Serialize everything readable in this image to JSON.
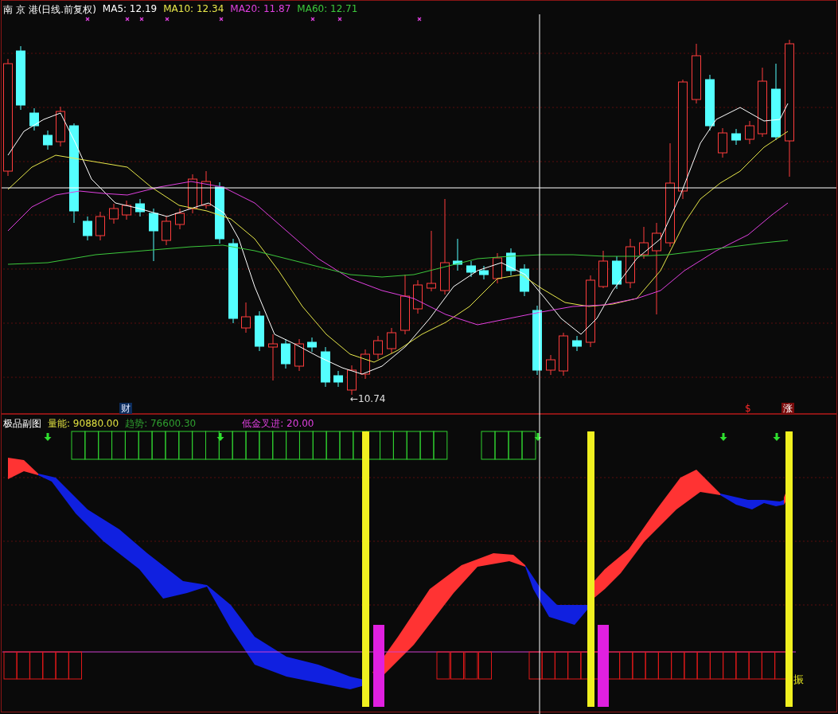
{
  "main_chart": {
    "title": "南 京 港(日线.前复权)",
    "indicators": [
      {
        "label": "MA5: 12.19",
        "color": "#ffffff"
      },
      {
        "label": "MA10: 12.34",
        "color": "#e8e84a"
      },
      {
        "label": "MA20: 11.87",
        "color": "#e040e0"
      },
      {
        "label": "MA60: 12.71",
        "color": "#3cc83c"
      }
    ],
    "low_label": "←10.74",
    "markers": [
      {
        "text": "财",
        "kind": "news"
      },
      {
        "text": "$",
        "kind": "dividend"
      },
      {
        "text": "涨",
        "kind": "limit"
      }
    ]
  },
  "sub_chart": {
    "title": "极品副图",
    "indicators": [
      {
        "label": "量能: 90880.00",
        "color": "#e0e040"
      },
      {
        "label": "趋势: 76600.30",
        "color": "#2f9f2f"
      },
      {
        "label": "低金叉进: 20.00",
        "color": "#e040e0"
      }
    ],
    "signal_label": "振"
  }
}
